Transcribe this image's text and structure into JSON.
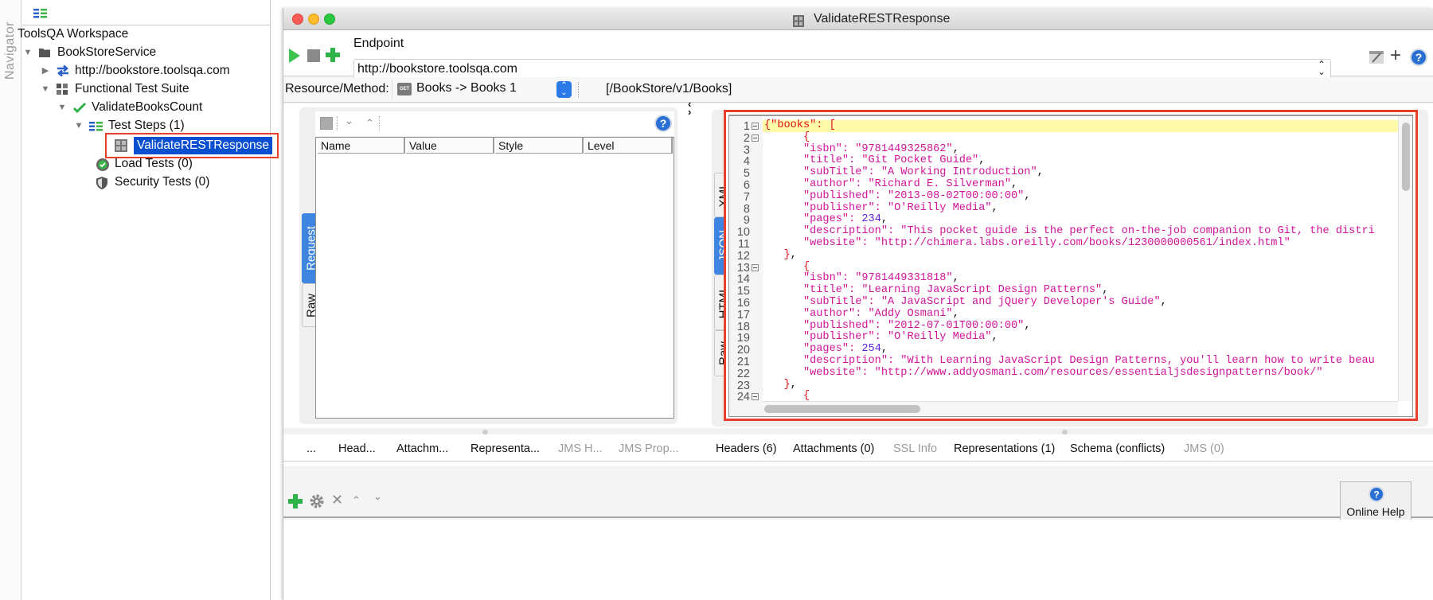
{
  "navigator": {
    "label": "Navigator"
  },
  "tree": {
    "workspace": "ToolsQA Workspace",
    "items": [
      {
        "label": "BookStoreService",
        "icon": "folder-icon",
        "expanded": true
      },
      {
        "label": "http://bookstore.toolsqa.com",
        "icon": "endpoint-arrows-icon",
        "expanded": false
      },
      {
        "label": "Functional Test Suite",
        "icon": "test-suite-icon",
        "expanded": true
      },
      {
        "label": "ValidateBooksCount",
        "icon": "checkmark-icon",
        "expanded": true
      },
      {
        "label": "Test Steps (1)",
        "icon": "test-steps-icon",
        "expanded": true
      },
      {
        "label": "ValidateRESTResponse",
        "icon": "rest-request-icon",
        "selected": true
      },
      {
        "label": "Load Tests (0)",
        "icon": "load-test-icon"
      },
      {
        "label": "Security Tests (0)",
        "icon": "shield-icon"
      }
    ]
  },
  "window": {
    "title": "ValidateRESTResponse",
    "endpoint_label": "Endpoint",
    "endpoint_value": "http://bookstore.toolsqa.com",
    "resource_label": "Resource/Method:",
    "method_badge": "GET",
    "resource_value": "Books -> Books 1",
    "resource_path": "[/BookStore/v1/Books]"
  },
  "request": {
    "tabs": [
      "Request",
      "Raw"
    ],
    "active_tab": "Request",
    "columns": [
      "Name",
      "Value",
      "Style",
      "Level"
    ],
    "bottom_tabs": [
      {
        "label": "...",
        "enabled": true
      },
      {
        "label": "Head...",
        "enabled": true
      },
      {
        "label": "Attachm...",
        "enabled": true
      },
      {
        "label": "Representa...",
        "enabled": true
      },
      {
        "label": "JMS H...",
        "enabled": false
      },
      {
        "label": "JMS Prop...",
        "enabled": false
      }
    ]
  },
  "response": {
    "tabs": [
      "XML",
      "JSON",
      "HTML",
      "Raw"
    ],
    "active_tab": "JSON",
    "lines": [
      {
        "n": "1",
        "fold": true,
        "parts": [
          [
            "red",
            "{\"books\": ["
          ]
        ]
      },
      {
        "n": "2",
        "fold": true,
        "parts": [
          [
            "red",
            "      {"
          ]
        ]
      },
      {
        "n": "3",
        "parts": [
          [
            "mag",
            "      \"isbn\": \"9781449325862\""
          ],
          [
            "blk",
            ","
          ]
        ]
      },
      {
        "n": "4",
        "parts": [
          [
            "mag",
            "      \"title\": \"Git Pocket Guide\""
          ],
          [
            "blk",
            ","
          ]
        ]
      },
      {
        "n": "5",
        "parts": [
          [
            "mag",
            "      \"subTitle\": \"A Working Introduction\""
          ],
          [
            "blk",
            ","
          ]
        ]
      },
      {
        "n": "6",
        "parts": [
          [
            "mag",
            "      \"author\": \"Richard E. Silverman\""
          ],
          [
            "blk",
            ","
          ]
        ]
      },
      {
        "n": "7",
        "parts": [
          [
            "mag",
            "      \"published\": \"2013-08-02T00:00:00\""
          ],
          [
            "blk",
            ","
          ]
        ]
      },
      {
        "n": "8",
        "parts": [
          [
            "mag",
            "      \"publisher\": \"O'Reilly Media\""
          ],
          [
            "blk",
            ","
          ]
        ]
      },
      {
        "n": "9",
        "parts": [
          [
            "mag",
            "      \"pages\": "
          ],
          [
            "num",
            "234"
          ],
          [
            "blk",
            ","
          ]
        ]
      },
      {
        "n": "10",
        "parts": [
          [
            "mag",
            "      \"description\": \"This pocket guide is the perfect on-the-job companion to Git, the distri"
          ]
        ]
      },
      {
        "n": "11",
        "parts": [
          [
            "mag",
            "      \"website\": \"http://chimera.labs.oreilly.com/books/1230000000561/index.html\""
          ]
        ]
      },
      {
        "n": "12",
        "parts": [
          [
            "red",
            "   }"
          ],
          [
            "blk",
            ","
          ]
        ]
      },
      {
        "n": "13",
        "fold": true,
        "parts": [
          [
            "red",
            "      {"
          ]
        ]
      },
      {
        "n": "14",
        "parts": [
          [
            "mag",
            "      \"isbn\": \"9781449331818\""
          ],
          [
            "blk",
            ","
          ]
        ]
      },
      {
        "n": "15",
        "parts": [
          [
            "mag",
            "      \"title\": \"Learning JavaScript Design Patterns\""
          ],
          [
            "blk",
            ","
          ]
        ]
      },
      {
        "n": "16",
        "parts": [
          [
            "mag",
            "      \"subTitle\": \"A JavaScript and jQuery Developer's Guide\""
          ],
          [
            "blk",
            ","
          ]
        ]
      },
      {
        "n": "17",
        "parts": [
          [
            "mag",
            "      \"author\": \"Addy Osmani\""
          ],
          [
            "blk",
            ","
          ]
        ]
      },
      {
        "n": "18",
        "parts": [
          [
            "mag",
            "      \"published\": \"2012-07-01T00:00:00\""
          ],
          [
            "blk",
            ","
          ]
        ]
      },
      {
        "n": "19",
        "parts": [
          [
            "mag",
            "      \"publisher\": \"O'Reilly Media\""
          ],
          [
            "blk",
            ","
          ]
        ]
      },
      {
        "n": "20",
        "parts": [
          [
            "mag",
            "      \"pages\": "
          ],
          [
            "num",
            "254"
          ],
          [
            "blk",
            ","
          ]
        ]
      },
      {
        "n": "21",
        "parts": [
          [
            "mag",
            "      \"description\": \"With Learning JavaScript Design Patterns, you'll learn how to write beau"
          ]
        ]
      },
      {
        "n": "22",
        "parts": [
          [
            "mag",
            "      \"website\": \"http://www.addyosmani.com/resources/essentialjsdesignpatterns/book/\""
          ]
        ]
      },
      {
        "n": "23",
        "parts": [
          [
            "red",
            "   }"
          ],
          [
            "blk",
            ","
          ]
        ]
      },
      {
        "n": "24",
        "fold": true,
        "parts": [
          [
            "red",
            "      {"
          ]
        ]
      }
    ],
    "bottom_tabs": [
      {
        "label": "Headers (6)",
        "enabled": true
      },
      {
        "label": "Attachments (0)",
        "enabled": true
      },
      {
        "label": "SSL Info",
        "enabled": false
      },
      {
        "label": "Representations (1)",
        "enabled": true
      },
      {
        "label": "Schema (conflicts)",
        "enabled": true
      },
      {
        "label": "JMS (0)",
        "enabled": false
      }
    ]
  },
  "assertions": {
    "online_help_label": "Online Help"
  },
  "colors": {
    "selection": "#0b4fd1",
    "highlight_box": "#e8402a",
    "active_tab": "#3d85e0",
    "json_brace": "#e0121c",
    "json_string": "#d0149a",
    "json_number": "#5a20d8",
    "current_line": "#fffaa8"
  }
}
